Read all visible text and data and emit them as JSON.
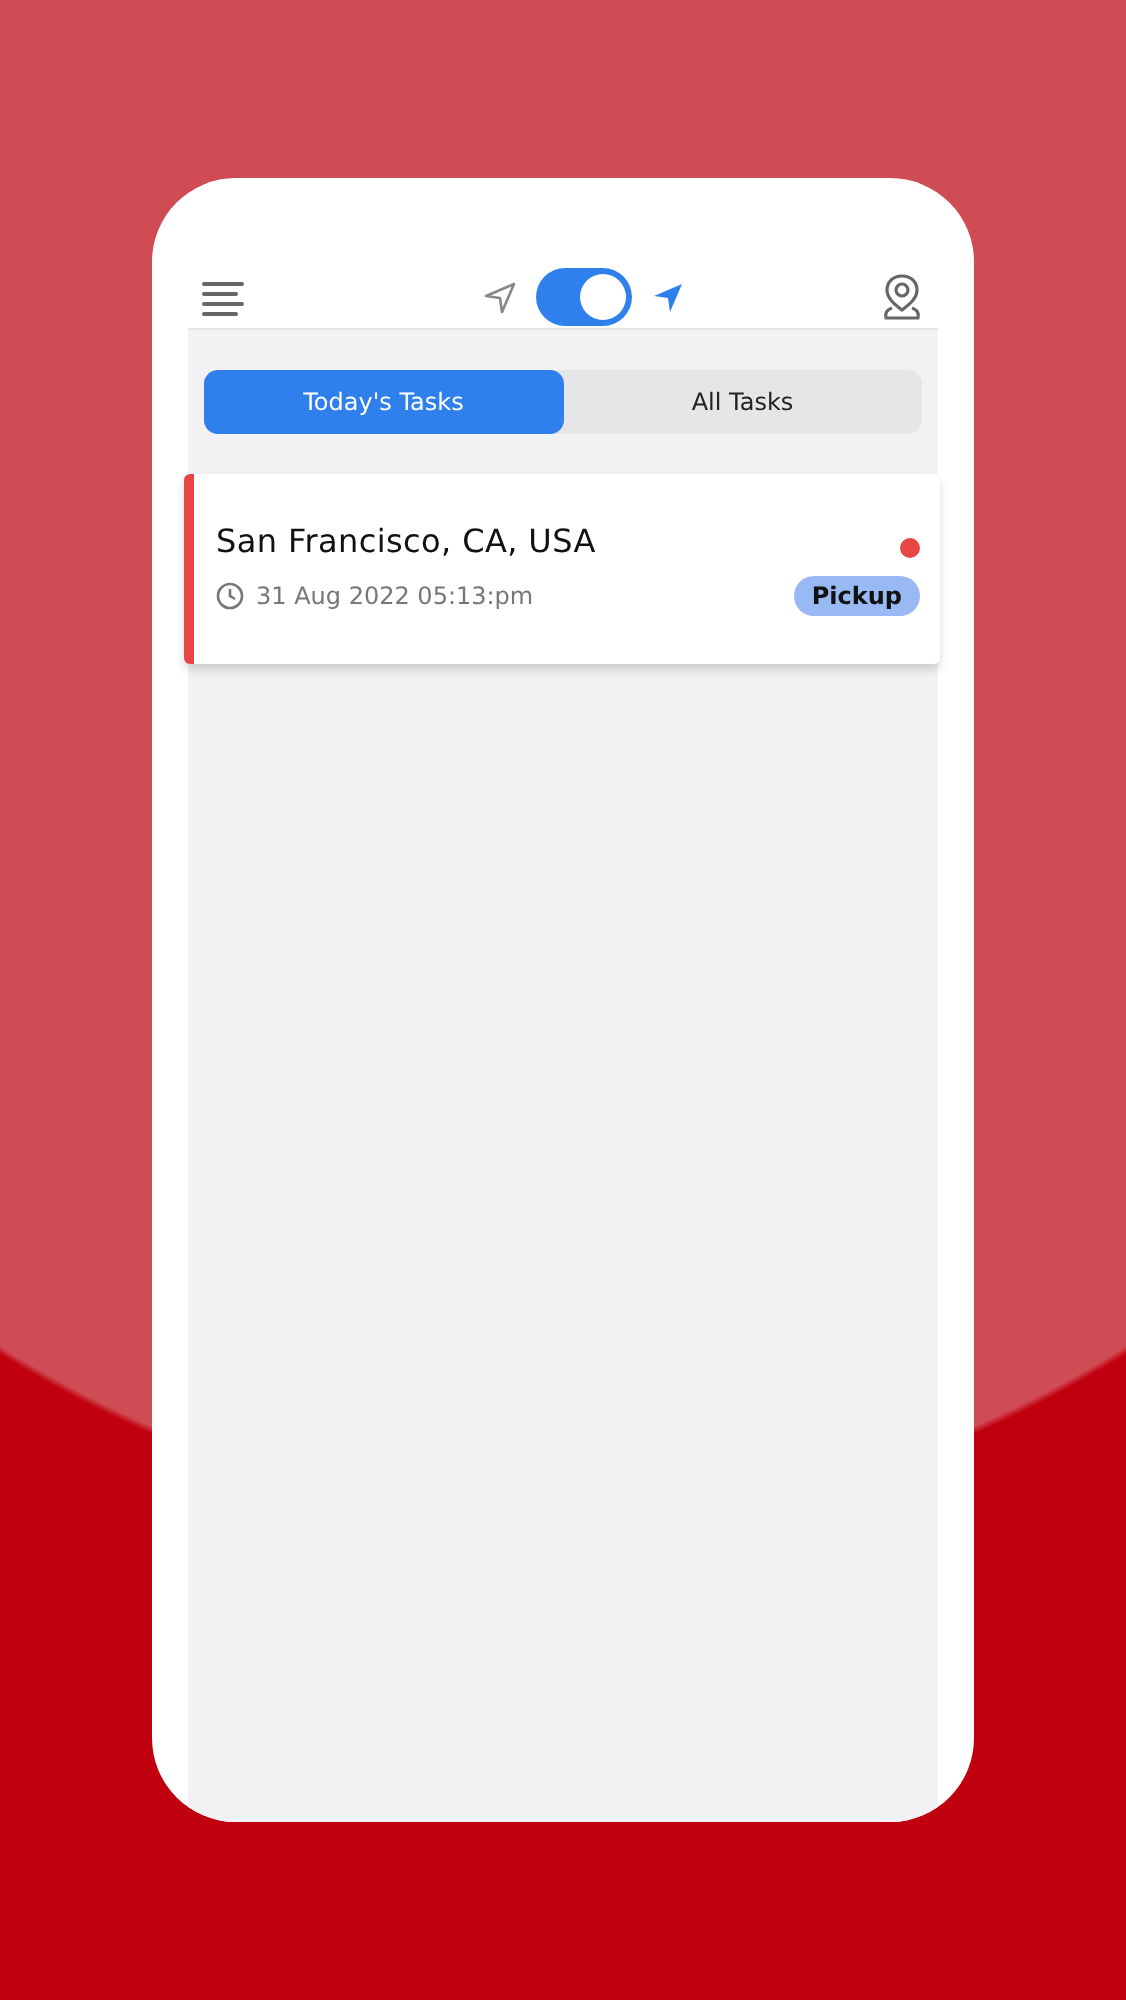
{
  "header": {
    "location_tracking": {
      "on": true
    }
  },
  "tabs": [
    {
      "label": "Today's Tasks",
      "selected": true
    },
    {
      "label": "All Tasks",
      "selected": false
    }
  ],
  "tasks": [
    {
      "address": "San Francisco, CA, USA",
      "time": "31 Aug 2022 05:13:pm",
      "tag": "Pickup",
      "color": "#e84545"
    }
  ]
}
